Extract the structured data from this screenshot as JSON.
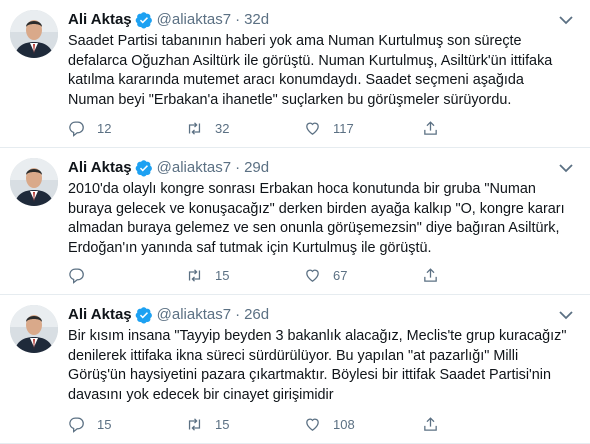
{
  "tweets": [
    {
      "author_name": "Ali Aktaş",
      "handle": "@aliaktas7",
      "separator": "·",
      "time": "32d",
      "text": "Saadet Partisi tabanının haberi yok ama Numan Kurtulmuş son süreçte defalarca Oğuzhan Asiltürk ile görüştü. Numan Kurtulmuş, Asiltürk'ün ittifaka katılma kararında mutemet aracı konumdaydı. Saadet seçmeni aşağıda Numan beyi \"Erbakan'a ihanetle\" suçlarken bu görüşmeler sürüyordu.",
      "replies": "12",
      "retweets": "32",
      "likes": "117"
    },
    {
      "author_name": "Ali Aktaş",
      "handle": "@aliaktas7",
      "separator": "·",
      "time": "29d",
      "text": "2010'da olaylı kongre sonrası Erbakan hoca konutunda bir gruba \"Numan buraya gelecek ve konuşacağız\" derken birden ayağa kalkıp \"O, kongre kararı almadan buraya gelemez ve sen onunla görüşemezsin\" diye bağıran Asiltürk, Erdoğan'ın yanında saf tutmak için Kurtulmuş ile görüştü.",
      "replies": "",
      "retweets": "15",
      "likes": "67"
    },
    {
      "author_name": "Ali Aktaş",
      "handle": "@aliaktas7",
      "separator": "·",
      "time": "26d",
      "text": "Bir kısım insana \"Tayyip beyden 3 bakanlık alacağız, Meclis'te grup kuracağız\" denilerek ittifaka ikna süreci sürdürülüyor. Bu yapılan \"at pazarlığı\" Milli Görüş'ün haysiyetini pazara çıkartmaktır. Böylesi bir ittifak Saadet Partisi'nin davasını yok edecek bir cinayet girişimidir",
      "replies": "15",
      "retweets": "15",
      "likes": "108"
    }
  ],
  "icons": {
    "verified": "verified-badge-icon",
    "more": "more-chevron-icon",
    "reply": "reply-icon",
    "retweet": "retweet-icon",
    "like": "heart-icon",
    "share": "share-icon"
  },
  "colors": {
    "verified": "#1da1f2",
    "muted": "#5b7083",
    "divider": "#e6ecf0"
  }
}
